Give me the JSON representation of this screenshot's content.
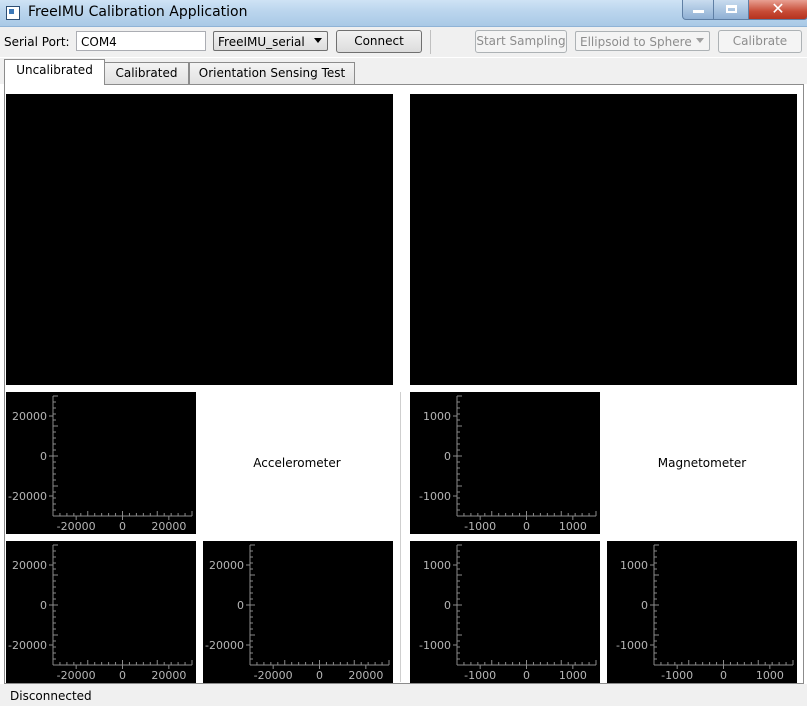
{
  "window": {
    "title": "FreeIMU Calibration Application",
    "close_glyph": "✕"
  },
  "toolbar": {
    "serial_port_label": "Serial Port:",
    "serial_port_value": "COM4",
    "protocol_value": "FreeIMU_serial",
    "connect_label": "Connect",
    "start_sampling_label": "Start Sampling",
    "fit_mode_value": "Ellipsoid to Sphere",
    "calibrate_label": "Calibrate"
  },
  "tabs": [
    {
      "label": "Uncalibrated"
    },
    {
      "label": "Calibrated"
    },
    {
      "label": "Orientation Sensing Test"
    }
  ],
  "groups": {
    "accelerometer_label": "Accelerometer",
    "magnetometer_label": "Magnetometer"
  },
  "plots": {
    "acc": {
      "y_ticks": [
        "20000",
        "0",
        "-20000"
      ],
      "x_ticks": [
        "-20000",
        "0",
        "20000"
      ],
      "y_tick_values": [
        20000,
        0,
        -20000
      ],
      "x_tick_values": [
        -20000,
        0,
        20000
      ]
    },
    "mag": {
      "y_ticks": [
        "1000",
        "0",
        "-1000"
      ],
      "x_ticks": [
        "-1000",
        "0",
        "1000"
      ],
      "y_tick_values": [
        1000,
        0,
        -1000
      ],
      "x_tick_values": [
        -1000,
        0,
        1000
      ]
    }
  },
  "status": {
    "text": "Disconnected"
  },
  "colors": {
    "plot_background": "#000000",
    "axis_color": "#8a8a8a",
    "tick_label_color": "#b5b5b5"
  }
}
